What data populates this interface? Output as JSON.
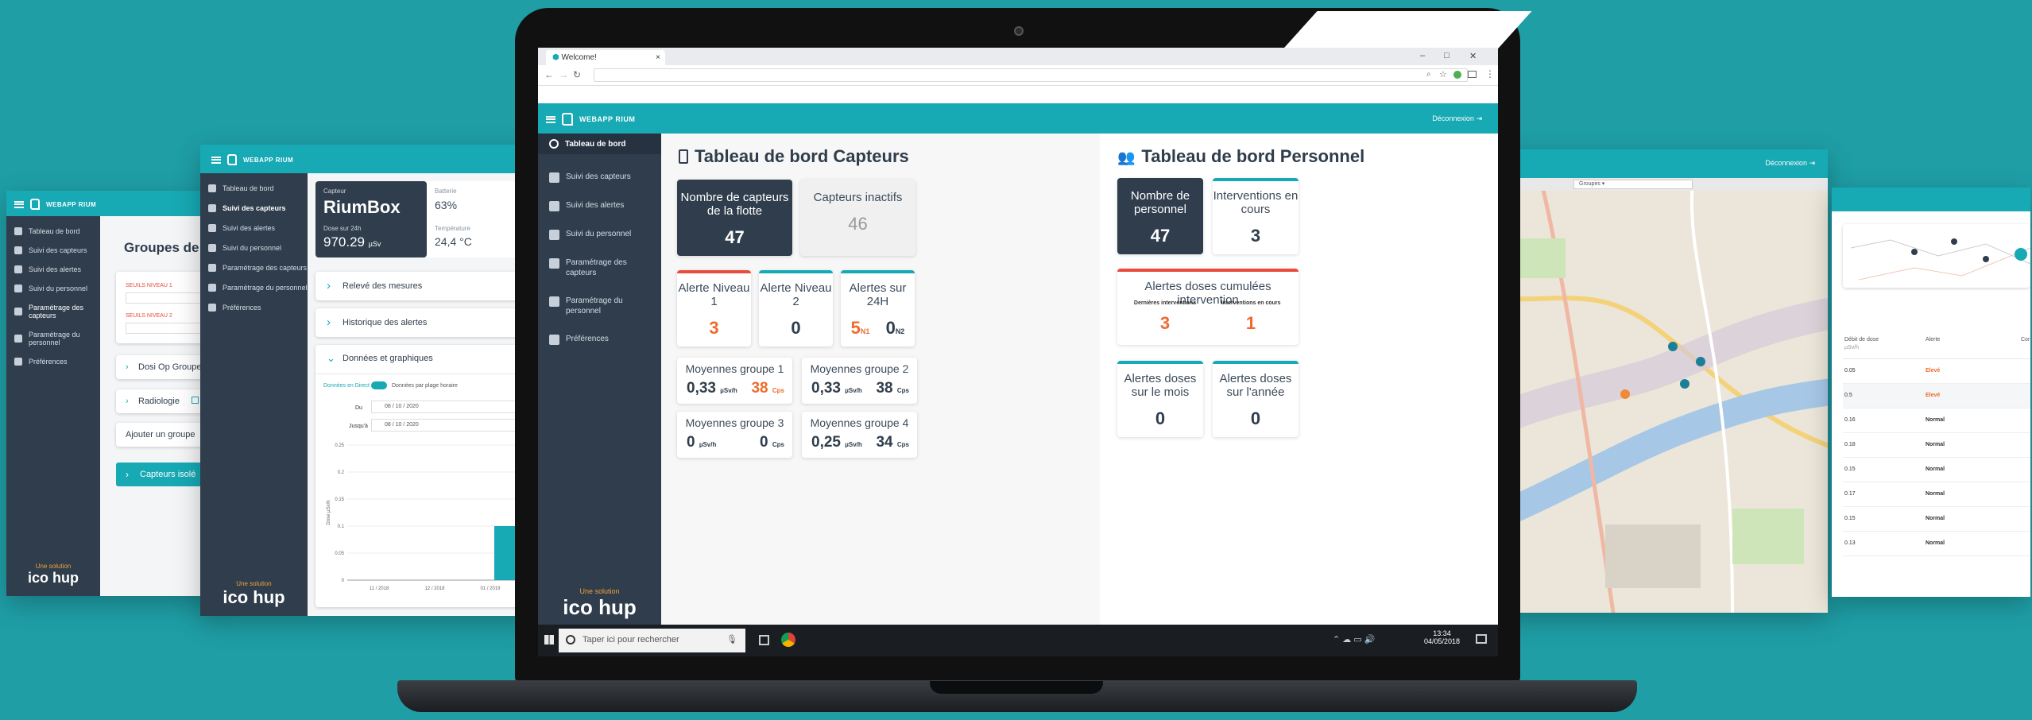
{
  "brand": {
    "name": "WEBAPP RIUM",
    "solution": "Une solution",
    "company": "ico hup",
    "logout": "Déconnexion"
  },
  "browser": {
    "tab_title": "Welcome!",
    "win_min": "–",
    "win_max": "□",
    "win_close": "✕"
  },
  "sidebar": {
    "items": [
      {
        "label": "Tableau de bord",
        "icon": "dashboard-icon"
      },
      {
        "label": "Suivi des capteurs",
        "icon": "wifi-icon"
      },
      {
        "label": "Suivi des alertes",
        "icon": "warning-icon"
      },
      {
        "label": "Suivi du personnel",
        "icon": "users-icon"
      },
      {
        "label": "Paramétrage des capteurs",
        "icon": "gear-icon"
      },
      {
        "label": "Paramétrage du personnel",
        "icon": "user-settings-icon"
      },
      {
        "label": "Préférences",
        "icon": "sliders-icon"
      }
    ]
  },
  "capteurs": {
    "title": "Tableau de bord Capteurs",
    "flotte_label": "Nombre de capteurs de la flotte",
    "flotte_value": "47",
    "inactifs_label": "Capteurs inactifs",
    "inactifs_value": "46",
    "n1_label": "Alerte Niveau 1",
    "n1_value": "3",
    "n2_label": "Alerte Niveau 2",
    "n2_value": "0",
    "h24_label": "Alertes sur 24H",
    "h24_n1": "5",
    "h24_n1_tag": "N1",
    "h24_n2": "0",
    "h24_n2_tag": "N2",
    "groups": [
      {
        "label": "Moyennes groupe 1",
        "dose": "0,33",
        "dose_unit": "µSv/h",
        "cps": "38",
        "cps_unit": "Cps",
        "cps_alert": true
      },
      {
        "label": "Moyennes groupe 2",
        "dose": "0,33",
        "dose_unit": "µSv/h",
        "cps": "38",
        "cps_unit": "Cps",
        "cps_alert": false
      },
      {
        "label": "Moyennes groupe 3",
        "dose": "0",
        "dose_unit": "µSv/h",
        "cps": "0",
        "cps_unit": "Cps",
        "cps_alert": false
      },
      {
        "label": "Moyennes groupe 4",
        "dose": "0,25",
        "dose_unit": "µSv/h",
        "cps": "34",
        "cps_unit": "Cps",
        "cps_alert": false
      }
    ]
  },
  "personnel": {
    "title": "Tableau de bord Personnel",
    "count_label": "Nombre de personnel",
    "count_value": "47",
    "interv_label": "Interventions en cours",
    "interv_value": "3",
    "cumul_title": "Alertes doses cumulées intervention",
    "last_label": "Dernières interventions",
    "last_value": "3",
    "current_label": "Interventions en cours",
    "current_value": "1",
    "month_label": "Alertes doses sur le mois",
    "month_value": "0",
    "year_label": "Alertes doses sur l'année",
    "year_value": "0"
  },
  "taskbar": {
    "search_placeholder": "Taper ici pour rechercher",
    "time": "13:34",
    "date": "04/05/2018"
  },
  "panel_left": {
    "title": "Groupes de capt",
    "seuil1": "SEUILS NIVEAU 1",
    "seuil2": "SEUILS NIVEAU 2",
    "groups": [
      "Dosi Op Groupe",
      "Radiologie"
    ],
    "add_group": "Ajouter un groupe",
    "capteurs_btn": "Capteurs isolé"
  },
  "panel_mid": {
    "capteur_label": "Capteur",
    "capteur_name": "RiumBox",
    "batterie_label": "Batterie",
    "batterie_value": "63%",
    "dose_label": "Dose sur 24h",
    "dose_value": "970.29",
    "dose_unit": "µSv",
    "temp_label": "Température",
    "temp_value": "24,4 °C",
    "releve": "Relevé des mesures",
    "historique": "Historique des alertes",
    "donnees": "Données et graphiques",
    "toggle_left": "Données en Direct",
    "toggle_right": "Données par plage horaire",
    "du_label": "Du",
    "du_value": "08 / 10 / 2020",
    "au_label": "Jusqu'à",
    "au_value": "08 / 10 / 2020",
    "y_ticks": [
      "0.25",
      "0.2",
      "0.15",
      "0.1",
      "0.05",
      "0"
    ],
    "x_ticks": [
      "11 / 2018",
      "12 / 2018",
      "01 / 2019"
    ],
    "ylabel": "Dose µSv/h",
    "bar_value": 0.1
  },
  "panel_map": {
    "groups_select": "Groupes"
  },
  "panel_right": {
    "col1": "Débit de dose",
    "col1_sub": "µSv/h",
    "col2": "Alerte",
    "col3": "Cor",
    "rows": [
      {
        "v": "0.05",
        "s": "Elevé",
        "alert": true
      },
      {
        "v": "0.5",
        "s": "Elevé",
        "alert": true
      },
      {
        "v": "0.16",
        "s": "Normal",
        "alert": false
      },
      {
        "v": "0.18",
        "s": "Normal",
        "alert": false
      },
      {
        "v": "0.15",
        "s": "Normal",
        "alert": false
      },
      {
        "v": "0.17",
        "s": "Normal",
        "alert": false
      },
      {
        "v": "0.15",
        "s": "Normal",
        "alert": false
      },
      {
        "v": "0.13",
        "s": "Normal",
        "alert": false
      }
    ]
  },
  "colors": {
    "teal": "#17a9b4",
    "navy": "#2f3d4c",
    "orange": "#ee6b2d",
    "red": "#e74c3c",
    "background": "#1f9ea6"
  }
}
